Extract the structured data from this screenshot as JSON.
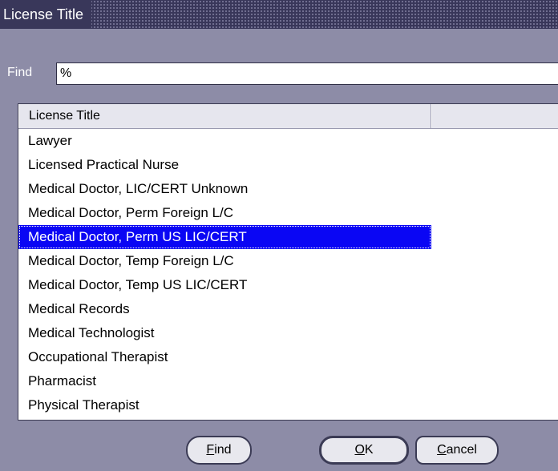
{
  "window": {
    "title": "License Title"
  },
  "find": {
    "label": "Find",
    "value": "%"
  },
  "list": {
    "column_header": "License Title",
    "selected_index": 4,
    "rows": [
      "Lawyer",
      "Licensed Practical Nurse",
      "Medical Doctor, LIC/CERT Unknown",
      "Medical Doctor, Perm Foreign L/C",
      "Medical Doctor, Perm US LIC/CERT",
      "Medical Doctor, Temp Foreign L/C",
      "Medical Doctor, Temp US LIC/CERT",
      "Medical Records",
      "Medical Technologist",
      "Occupational Therapist",
      "Pharmacist",
      "Physical Therapist"
    ]
  },
  "buttons": {
    "find": {
      "mnemonic": "F",
      "rest": "ind"
    },
    "ok": {
      "mnemonic": "O",
      "rest": "K"
    },
    "cancel": {
      "mnemonic": "C",
      "rest": "ancel"
    }
  },
  "colors": {
    "selection": "#0a06f4",
    "background": "#8d8ca7",
    "titlebar": "#39375a"
  }
}
